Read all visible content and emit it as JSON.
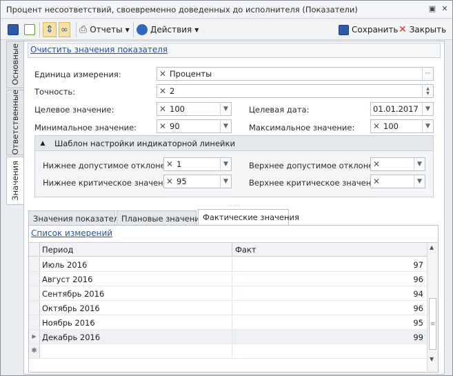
{
  "window": {
    "title": "Процент несоответствий, своевременно доведенных до исполнителя (Показатели)"
  },
  "toolbar": {
    "reports_label": "Отчеты",
    "actions_label": "Действия",
    "save_label": "Сохранить",
    "close_label": "Закрыть"
  },
  "side_tabs": [
    "Основные",
    "Ответственные",
    "Значения"
  ],
  "form": {
    "clear_link": "Очистить значения показателя",
    "unit": {
      "label": "Единица измерения:",
      "value": "Проценты"
    },
    "precision": {
      "label": "Точность:",
      "value": "2"
    },
    "target": {
      "label": "Целевое значение:",
      "value": "100"
    },
    "target_date": {
      "label": "Целевая дата:",
      "value": "01.01.2017"
    },
    "min": {
      "label": "Минимальное значение:",
      "value": "90"
    },
    "max": {
      "label": "Максимальное значение:",
      "value": "100"
    }
  },
  "indicator_group": {
    "title": "Шаблон настройки индикаторной линейки",
    "lower_allowed": {
      "label": "Нижнее допустимое отклонение:",
      "value": "1"
    },
    "upper_allowed": {
      "label": "Верхнее допустимое отклонение:",
      "value": ""
    },
    "lower_critical": {
      "label": "Нижнее критическое значение:",
      "value": "95"
    },
    "upper_critical": {
      "label": "Верхнее критическое значение:",
      "value": ""
    }
  },
  "tabs": [
    "Значения показателя",
    "Плановые значения",
    "Фактические значения"
  ],
  "grid": {
    "link": "Список измерений",
    "columns": [
      "Период",
      "Факт"
    ],
    "rows": [
      {
        "period": "Июль 2016",
        "fact": "97"
      },
      {
        "period": "Август 2016",
        "fact": "96"
      },
      {
        "period": "Сентябрь 2016",
        "fact": "94"
      },
      {
        "period": "Октябрь 2016",
        "fact": "96"
      },
      {
        "period": "Ноябрь 2016",
        "fact": "95"
      },
      {
        "period": "Декабрь 2016",
        "fact": "99"
      }
    ]
  }
}
